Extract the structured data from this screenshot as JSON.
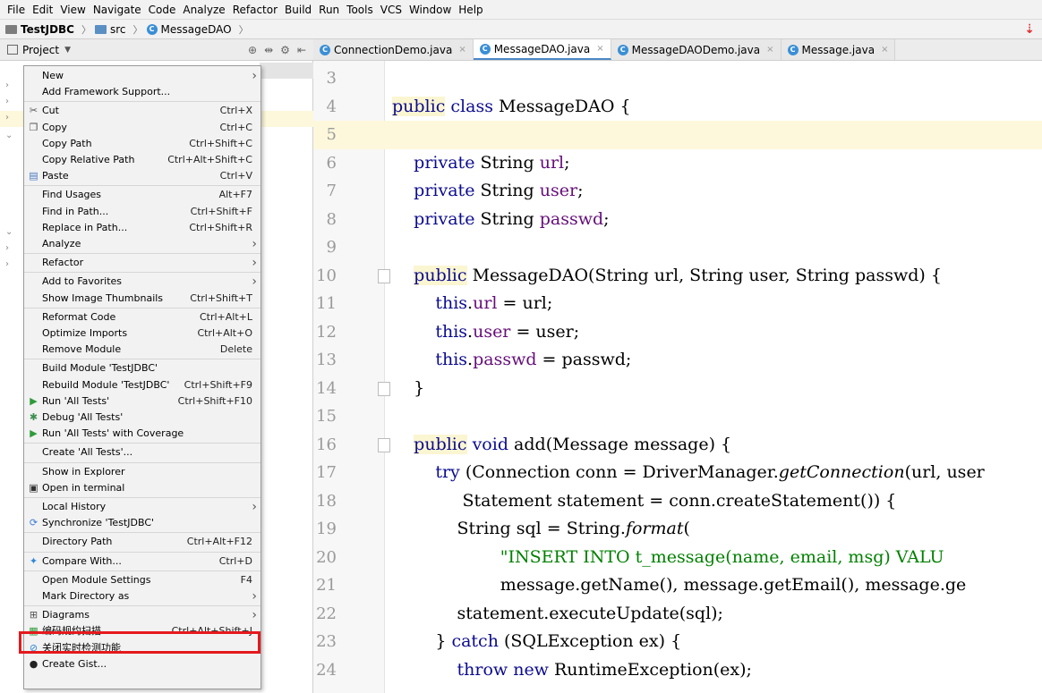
{
  "menubar": [
    "File",
    "Edit",
    "View",
    "Navigate",
    "Code",
    "Analyze",
    "Refactor",
    "Build",
    "Run",
    "Tools",
    "VCS",
    "Window",
    "Help"
  ],
  "navbar": {
    "project": "TestJDBC",
    "folder": "src",
    "file": "MessageDAO"
  },
  "project_panel": {
    "title": "Project"
  },
  "tabs": [
    {
      "label": "ConnectionDemo.java",
      "active": false
    },
    {
      "label": "MessageDAO.java",
      "active": true
    },
    {
      "label": "MessageDAODemo.java",
      "active": false
    },
    {
      "label": "Message.java",
      "active": false
    }
  ],
  "code_lines": [
    {
      "n": "3",
      "t": ""
    },
    {
      "n": "4",
      "t": "public class MessageDAO {"
    },
    {
      "n": "5",
      "t": ""
    },
    {
      "n": "6",
      "t": "    private String url;"
    },
    {
      "n": "7",
      "t": "    private String user;"
    },
    {
      "n": "8",
      "t": "    private String passwd;"
    },
    {
      "n": "9",
      "t": ""
    },
    {
      "n": "10",
      "t": "    public MessageDAO(String url, String user, String passwd) {"
    },
    {
      "n": "11",
      "t": "        this.url = url;"
    },
    {
      "n": "12",
      "t": "        this.user = user;"
    },
    {
      "n": "13",
      "t": "        this.passwd = passwd;"
    },
    {
      "n": "14",
      "t": "    }"
    },
    {
      "n": "15",
      "t": ""
    },
    {
      "n": "16",
      "t": "    public void add(Message message) {"
    },
    {
      "n": "17",
      "t": "        try (Connection conn = DriverManager.getConnection(url, user"
    },
    {
      "n": "18",
      "t": "             Statement statement = conn.createStatement()) {"
    },
    {
      "n": "19",
      "t": "            String sql = String.format("
    },
    {
      "n": "20",
      "t": "                    \"INSERT INTO t_message(name, email, msg) VALU"
    },
    {
      "n": "21",
      "t": "                    message.getName(), message.getEmail(), message.ge"
    },
    {
      "n": "22",
      "t": "            statement.executeUpdate(sql);"
    },
    {
      "n": "23",
      "t": "        } catch (SQLException ex) {"
    },
    {
      "n": "24",
      "t": "            throw new RuntimeException(ex);"
    }
  ],
  "context_menu": [
    {
      "label": "New",
      "shortcut": "",
      "submenu": true,
      "icon": ""
    },
    {
      "label": "Add Framework Support...",
      "shortcut": "",
      "submenu": false,
      "icon": ""
    },
    {
      "divider": true
    },
    {
      "label": "Cut",
      "shortcut": "Ctrl+X",
      "submenu": false,
      "icon": "scissors-icon"
    },
    {
      "label": "Copy",
      "shortcut": "Ctrl+C",
      "submenu": false,
      "icon": "copy-icon"
    },
    {
      "label": "Copy Path",
      "shortcut": "Ctrl+Shift+C",
      "submenu": false,
      "icon": ""
    },
    {
      "label": "Copy Relative Path",
      "shortcut": "Ctrl+Alt+Shift+C",
      "submenu": false,
      "icon": ""
    },
    {
      "label": "Paste",
      "shortcut": "Ctrl+V",
      "submenu": false,
      "icon": "paste-icon"
    },
    {
      "divider": true
    },
    {
      "label": "Find Usages",
      "shortcut": "Alt+F7",
      "submenu": false,
      "icon": ""
    },
    {
      "label": "Find in Path...",
      "shortcut": "Ctrl+Shift+F",
      "submenu": false,
      "icon": ""
    },
    {
      "label": "Replace in Path...",
      "shortcut": "Ctrl+Shift+R",
      "submenu": false,
      "icon": ""
    },
    {
      "label": "Analyze",
      "shortcut": "",
      "submenu": true,
      "icon": ""
    },
    {
      "divider": true
    },
    {
      "label": "Refactor",
      "shortcut": "",
      "submenu": true,
      "icon": ""
    },
    {
      "divider": true
    },
    {
      "label": "Add to Favorites",
      "shortcut": "",
      "submenu": true,
      "icon": ""
    },
    {
      "label": "Show Image Thumbnails",
      "shortcut": "Ctrl+Shift+T",
      "submenu": false,
      "icon": ""
    },
    {
      "divider": true
    },
    {
      "label": "Reformat Code",
      "shortcut": "Ctrl+Alt+L",
      "submenu": false,
      "icon": ""
    },
    {
      "label": "Optimize Imports",
      "shortcut": "Ctrl+Alt+O",
      "submenu": false,
      "icon": ""
    },
    {
      "label": "Remove Module",
      "shortcut": "Delete",
      "submenu": false,
      "icon": ""
    },
    {
      "divider": true
    },
    {
      "label": "Build Module 'TestJDBC'",
      "shortcut": "",
      "submenu": false,
      "icon": ""
    },
    {
      "label": "Rebuild Module 'TestJDBC'",
      "shortcut": "Ctrl+Shift+F9",
      "submenu": false,
      "icon": ""
    },
    {
      "label": "Run 'All Tests'",
      "shortcut": "Ctrl+Shift+F10",
      "submenu": false,
      "icon": "run-icon"
    },
    {
      "label": "Debug 'All Tests'",
      "shortcut": "",
      "submenu": false,
      "icon": "debug-icon"
    },
    {
      "label": "Run 'All Tests' with Coverage",
      "shortcut": "",
      "submenu": false,
      "icon": "coverage-icon"
    },
    {
      "divider": true
    },
    {
      "label": "Create 'All Tests'...",
      "shortcut": "",
      "submenu": false,
      "icon": ""
    },
    {
      "divider": true
    },
    {
      "label": "Show in Explorer",
      "shortcut": "",
      "submenu": false,
      "icon": ""
    },
    {
      "label": "Open in terminal",
      "shortcut": "",
      "submenu": false,
      "icon": "terminal-icon"
    },
    {
      "divider": true
    },
    {
      "label": "Local History",
      "shortcut": "",
      "submenu": true,
      "icon": ""
    },
    {
      "label": "Synchronize 'TestJDBC'",
      "shortcut": "",
      "submenu": false,
      "icon": "sync-icon"
    },
    {
      "divider": true
    },
    {
      "label": "Directory Path",
      "shortcut": "Ctrl+Alt+F12",
      "submenu": false,
      "icon": ""
    },
    {
      "divider": true
    },
    {
      "label": "Compare With...",
      "shortcut": "Ctrl+D",
      "submenu": false,
      "icon": "compare-icon"
    },
    {
      "divider": true
    },
    {
      "label": "Open Module Settings",
      "shortcut": "F4",
      "submenu": false,
      "icon": ""
    },
    {
      "label": "Mark Directory as",
      "shortcut": "",
      "submenu": true,
      "icon": ""
    },
    {
      "divider": true
    },
    {
      "label": "Diagrams",
      "shortcut": "",
      "submenu": true,
      "icon": "diagram-icon"
    },
    {
      "label": "编码规约扫描",
      "shortcut": "Ctrl+Alt+Shift+J",
      "submenu": false,
      "icon": "scan-icon"
    },
    {
      "label": "关闭实时检测功能",
      "shortcut": "",
      "submenu": false,
      "icon": "realtime-icon"
    },
    {
      "label": "Create Gist...",
      "shortcut": "",
      "submenu": false,
      "icon": "github-icon"
    }
  ]
}
